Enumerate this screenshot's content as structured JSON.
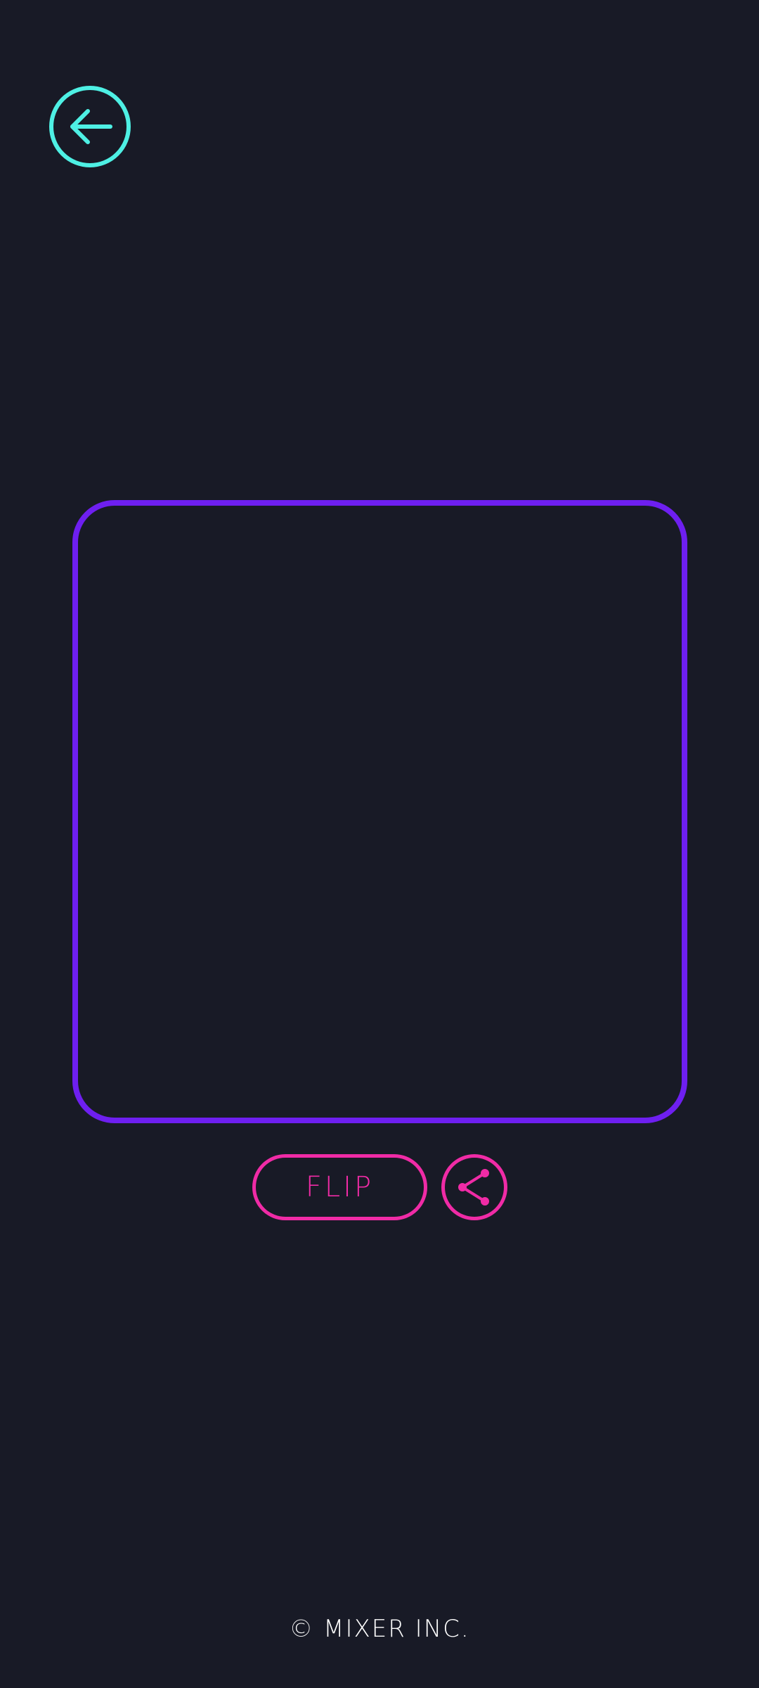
{
  "header": {
    "back_icon": "arrow-left-circle-icon",
    "back_color": "#4ef0e4"
  },
  "card": {
    "frame_color": "#6e1ff0"
  },
  "actions": {
    "flip_label": "FLIP",
    "share_icon": "share-icon",
    "accent_color": "#f02ba6"
  },
  "footer": {
    "copyright": "© MIXER INC."
  },
  "theme": {
    "background": "#181a26"
  }
}
